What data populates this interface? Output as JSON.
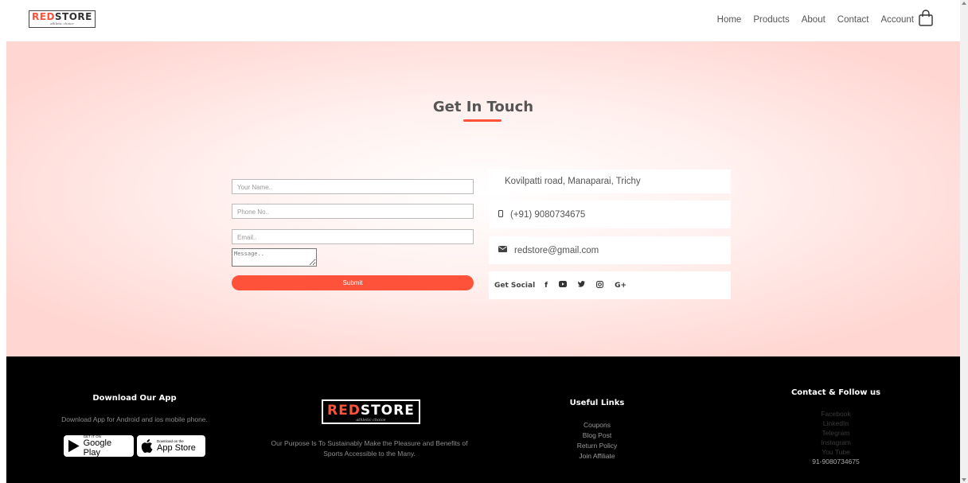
{
  "brand": {
    "name_red": "RED",
    "name_dark": "STORE",
    "tagline": "athletic choice",
    "accent_color": "#ff523b"
  },
  "nav": {
    "items": [
      "Home",
      "Products",
      "About",
      "Contact",
      "Account"
    ],
    "cart_icon": "shopping-bag-icon"
  },
  "contact": {
    "title": "Get In Touch",
    "form": {
      "name_placeholder": "Your Name..",
      "phone_placeholder": "Phone No..",
      "email_placeholder": "Email..",
      "message_placeholder": "Message..",
      "submit_label": "Submit"
    },
    "info": {
      "address": "Kovilpatti road, Manaparai, Trichy",
      "phone": "(+91) 9080734675",
      "email": "redstore@gmail.com",
      "social_label": "Get Social",
      "social_icons": [
        "facebook-icon",
        "youtube-icon",
        "twitter-icon",
        "instagram-icon",
        "google-plus-icon"
      ],
      "social_glyphs": [
        "f",
        "▶",
        "t",
        "◎",
        "G+"
      ]
    }
  },
  "footer": {
    "app": {
      "heading": "Download Our App",
      "text": "Download App for Android and ios mobile phone.",
      "google_small": "GET IT ON",
      "google_big": "Google Play",
      "apple_small": "Download on the",
      "apple_big": "App Store"
    },
    "about": {
      "text_line1": "Our Purpose Is To Sustainably Make the Pleasure and Benefits of",
      "text_line2": "Sports Accessible to the Many."
    },
    "useful": {
      "heading": "Useful Links",
      "links": [
        "Coupons",
        "Blog Post",
        "Return Policy",
        "Join Affiliate"
      ]
    },
    "follow": {
      "heading": "Contact & Follow us",
      "links": [
        "Facebook",
        "LinkedIn",
        "Telegram",
        "Instagram",
        "You Tube"
      ],
      "phone": "91-9080734675"
    }
  }
}
